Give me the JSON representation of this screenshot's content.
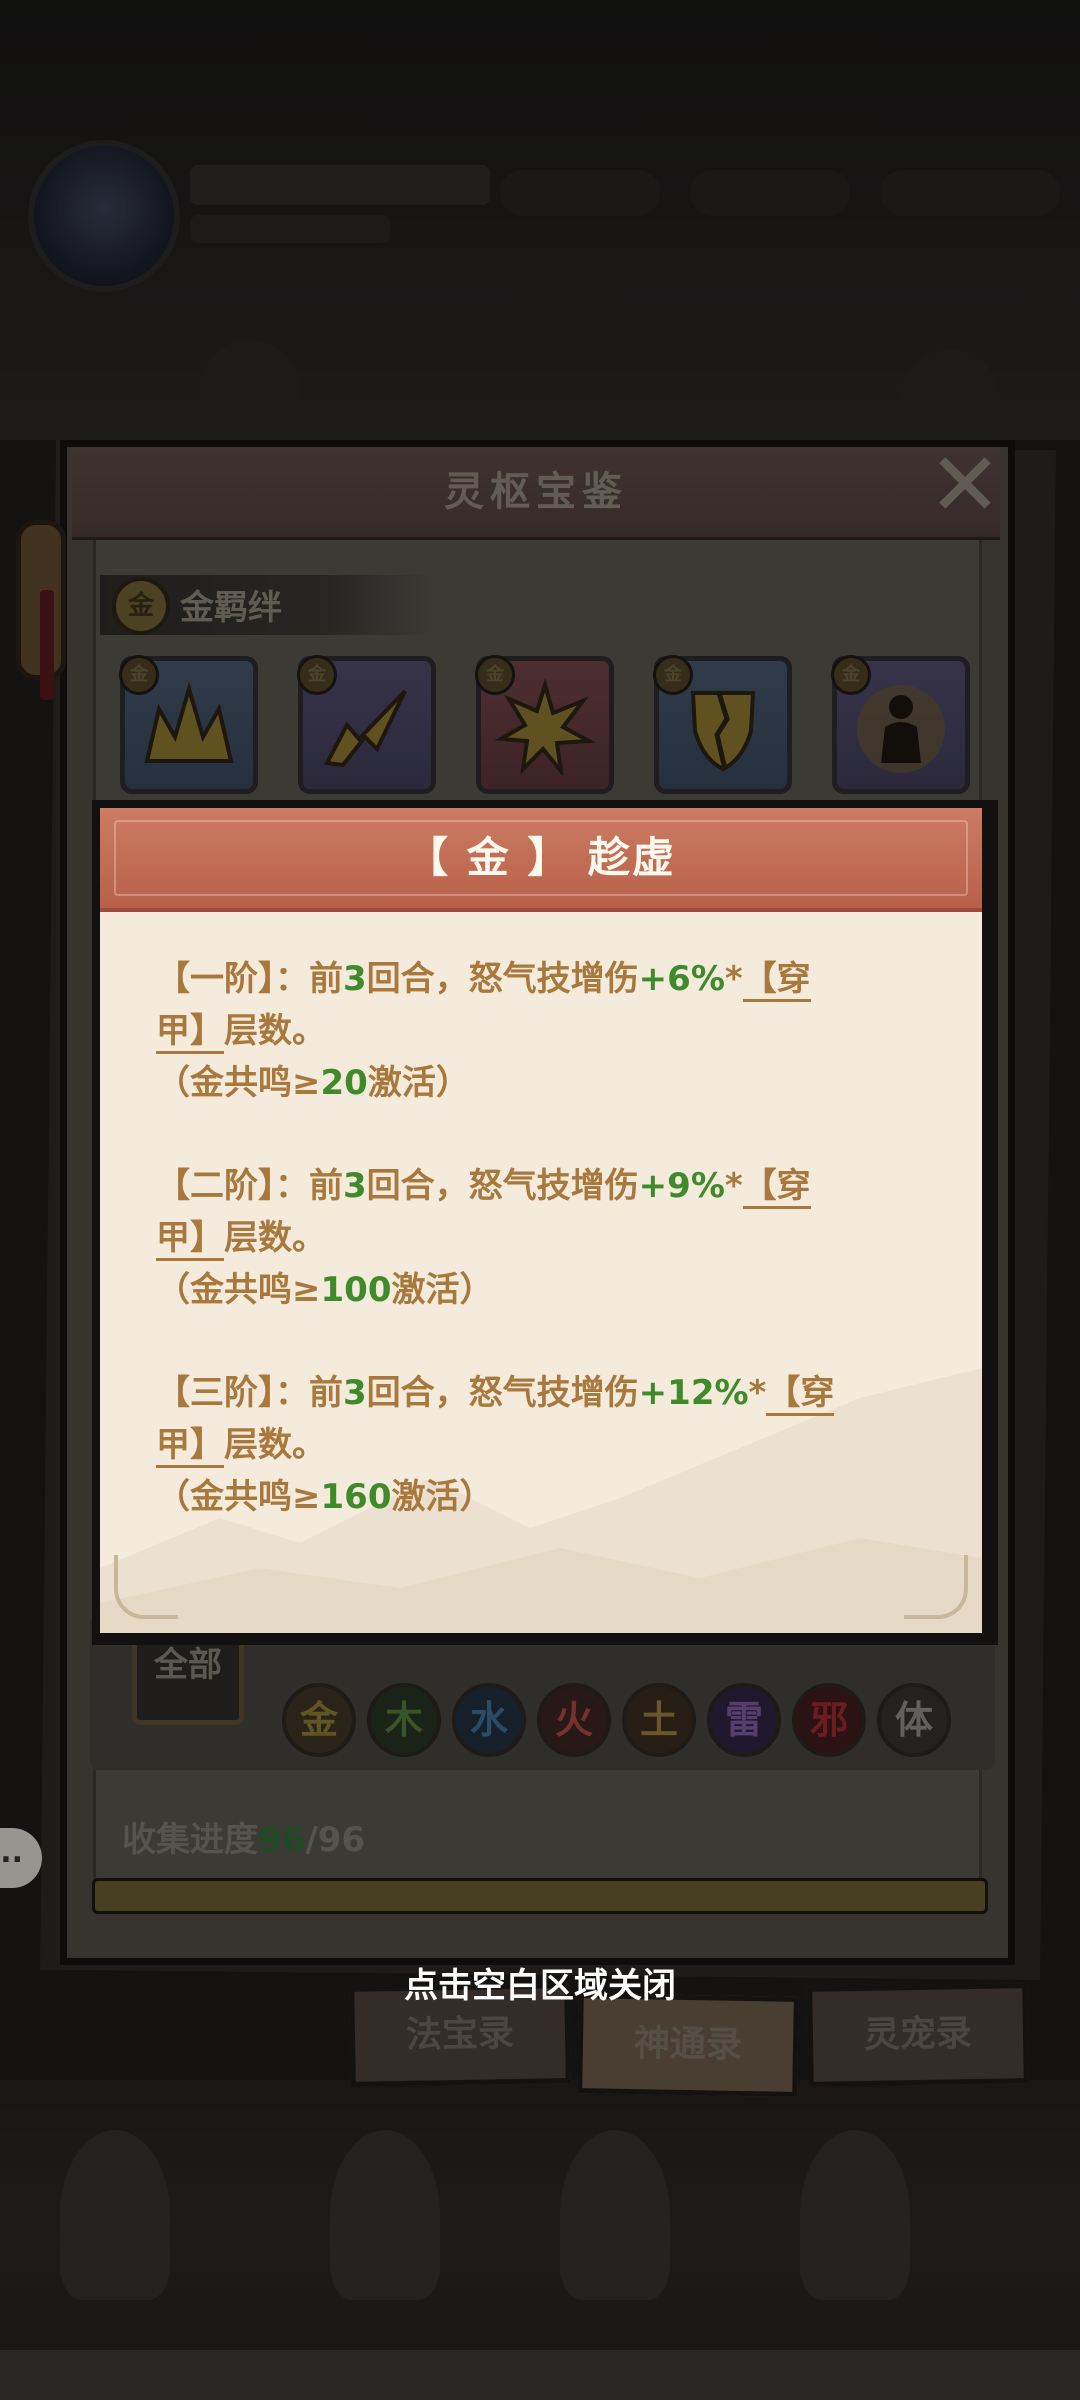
{
  "panel": {
    "title": "灵枢宝鉴",
    "bond_coin": "金",
    "bond_label": "金羁绊",
    "skills": [
      {
        "badge": "金",
        "color": "blue",
        "icon": "crown-spikes-icon"
      },
      {
        "badge": "金",
        "color": "purple",
        "icon": "slash-burst-icon"
      },
      {
        "badge": "金",
        "color": "red",
        "icon": "explosion-icon"
      },
      {
        "badge": "金",
        "color": "blue",
        "icon": "broken-shield-icon"
      },
      {
        "badge": "金",
        "color": "purple",
        "icon": "glowing-figure-icon"
      }
    ],
    "filter": {
      "all_label": "全部",
      "elements": [
        {
          "label": "金",
          "color": "#8c7a36"
        },
        {
          "label": "木",
          "color": "#4f7a3a"
        },
        {
          "label": "水",
          "color": "#3d6e94"
        },
        {
          "label": "火",
          "color": "#a8483e"
        },
        {
          "label": "土",
          "color": "#9a7b3f"
        },
        {
          "label": "雷",
          "color": "#7e5aa0"
        },
        {
          "label": "邪",
          "color": "#9c2a2f"
        },
        {
          "label": "体",
          "color": "#8c8a86"
        }
      ]
    },
    "progress": {
      "label": "收集进度",
      "current": "96",
      "sep": "/",
      "total": "96",
      "fraction": 1.0
    },
    "tabs": [
      {
        "label": "法宝录",
        "active": false
      },
      {
        "label": "神通录",
        "active": true
      },
      {
        "label": "灵宠录",
        "active": false
      }
    ],
    "side_chat": "..."
  },
  "popup": {
    "title": "【 金 】 趁虚",
    "tiers": [
      {
        "tier": "【一阶】",
        "colon": "：",
        "prefix": "前",
        "rounds": "3",
        "middle": "回合，怒气技增伤",
        "bonus": "+6%",
        "star": "*",
        "tag_a": "【穿",
        "tag_b": "甲】",
        "suffix": "层数。",
        "req_prefix": "（金共鸣",
        "req_sym": "≥",
        "req_value": "20",
        "req_suffix": "激活）"
      },
      {
        "tier": "【二阶】",
        "colon": "：",
        "prefix": "前",
        "rounds": "3",
        "middle": "回合，怒气技增伤",
        "bonus": "+9%",
        "star": "*",
        "tag_a": "【穿",
        "tag_b": "甲】",
        "suffix": "层数。",
        "req_prefix": "（金共鸣",
        "req_sym": "≥",
        "req_value": "100",
        "req_suffix": "激活）"
      },
      {
        "tier": "【三阶】",
        "colon": "：",
        "prefix": "前",
        "rounds": "3",
        "middle": "回合，怒气技增伤",
        "bonus": "+12%",
        "star": "*",
        "tag_a": "【穿",
        "tag_b": "甲】",
        "suffix": "层数。",
        "req_prefix": "（金共鸣",
        "req_sym": "≥",
        "req_value": "160",
        "req_suffix": "激活）"
      }
    ]
  },
  "close_hint": "点击空白区域关闭"
}
